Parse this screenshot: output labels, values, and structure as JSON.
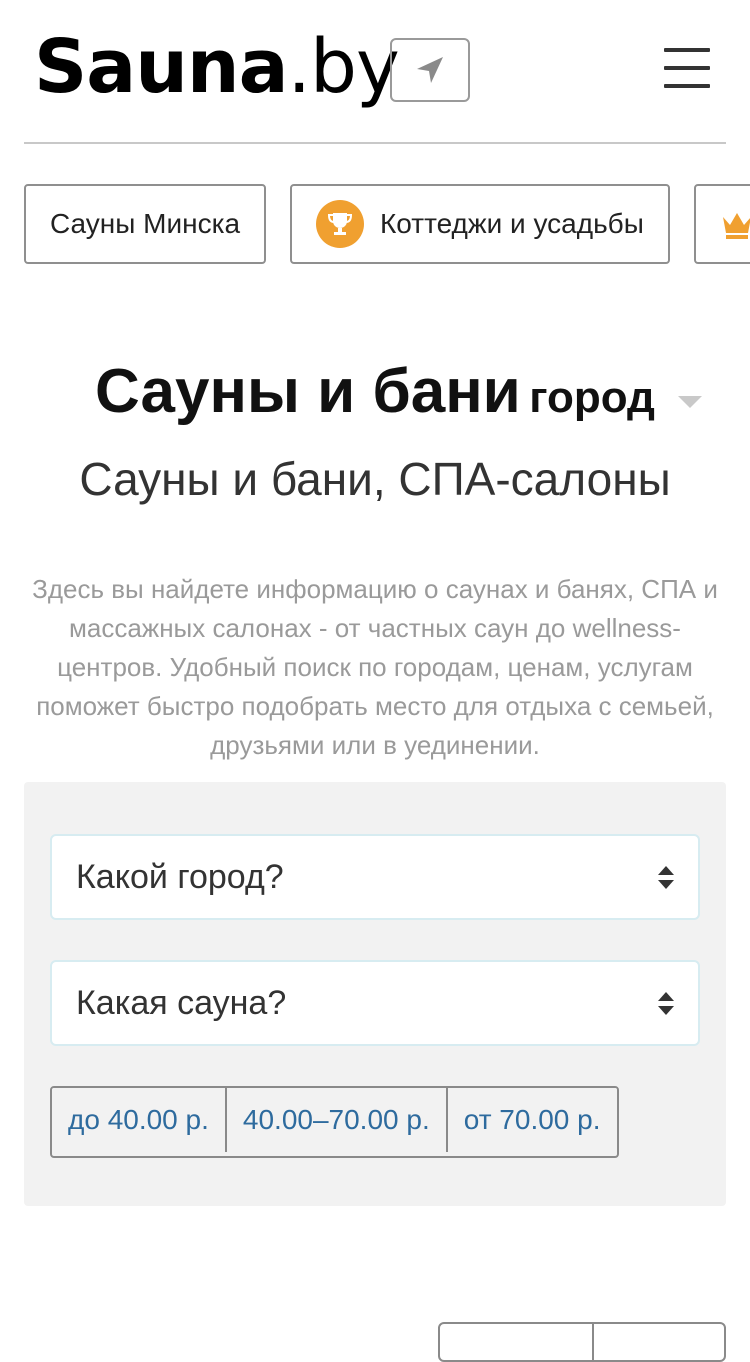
{
  "header": {
    "logo_bold": "Sauna",
    "logo_light": ".by",
    "locate_icon": "location-arrow-icon",
    "menu_icon": "hamburger-menu-icon"
  },
  "categories": [
    {
      "label": "Сауны Минска"
    },
    {
      "label": "Коттеджи и усадьбы",
      "icon": "trophy-icon"
    },
    {
      "label": "",
      "icon": "crown-icon"
    }
  ],
  "hero": {
    "title": "Сауны и бани",
    "city": "город",
    "subtitle": "Сауны и бани, СПА-салоны",
    "description": "Здесь вы найдете информацию о саунах и банях, СПА и массажных салонах - от частных саун до wellness-центров. Удобный поиск по городам, ценам, услугам поможет быстро подобрать место для отдыха с семьей, друзьями или в уединении."
  },
  "search": {
    "city_select": "Какой город?",
    "sauna_select": "Какая сауна?",
    "price_ranges": [
      "до 40.00 р.",
      "40.00–70.00 р.",
      "от 70.00 р."
    ]
  },
  "colors": {
    "accent_orange": "#f0a030",
    "link_blue": "#2e6b9e",
    "panel_bg": "#f2f2f2"
  }
}
